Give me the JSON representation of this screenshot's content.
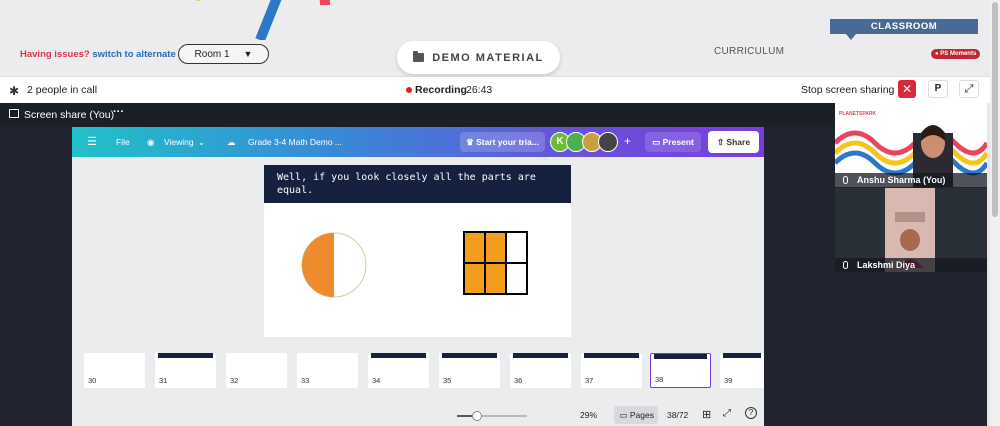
{
  "header": {
    "help_question": "Having issues?",
    "help_link": "switch to alternate room",
    "room_label": "Room 1",
    "demo_material": "DEMO MATERIAL",
    "curriculum": "CURRICULUM",
    "classroom": "CLASSROOM",
    "ps_moments": "PS Moments"
  },
  "call_bar": {
    "people": "2 people in call",
    "recording_label": "Recording",
    "recording_time": "26:43",
    "stop_sharing": "Stop screen sharing",
    "p_button": "P"
  },
  "share": {
    "label": "Screen share (You)",
    "more": "···"
  },
  "canva": {
    "file": "File",
    "viewing": "Viewing",
    "title": "Grade 3-4 Math Demo ...",
    "trial": "Start your tria...",
    "avatar_letter": "K",
    "present": "Present",
    "share": "Share",
    "slide_text": "Well, if you look closely all the parts are equal.",
    "thumbnails": [
      {
        "num": "30"
      },
      {
        "num": "31"
      },
      {
        "num": "32"
      },
      {
        "num": "33"
      },
      {
        "num": "34"
      },
      {
        "num": "35"
      },
      {
        "num": "36"
      },
      {
        "num": "37"
      },
      {
        "num": "38"
      },
      {
        "num": "39"
      }
    ],
    "zoom": "29%",
    "zoom_level": 0.29,
    "pages": "Pages",
    "page_count": "38/72",
    "help": "?"
  },
  "participants": [
    {
      "name": "Anshu Sharma (You)"
    },
    {
      "name": "Lakshmi Diya"
    }
  ],
  "colors": {
    "accent_red": "#d8283a",
    "classroom_blue": "#4a6a96",
    "slide_navy": "#15213f",
    "fraction_orange": "#f39c1e"
  }
}
